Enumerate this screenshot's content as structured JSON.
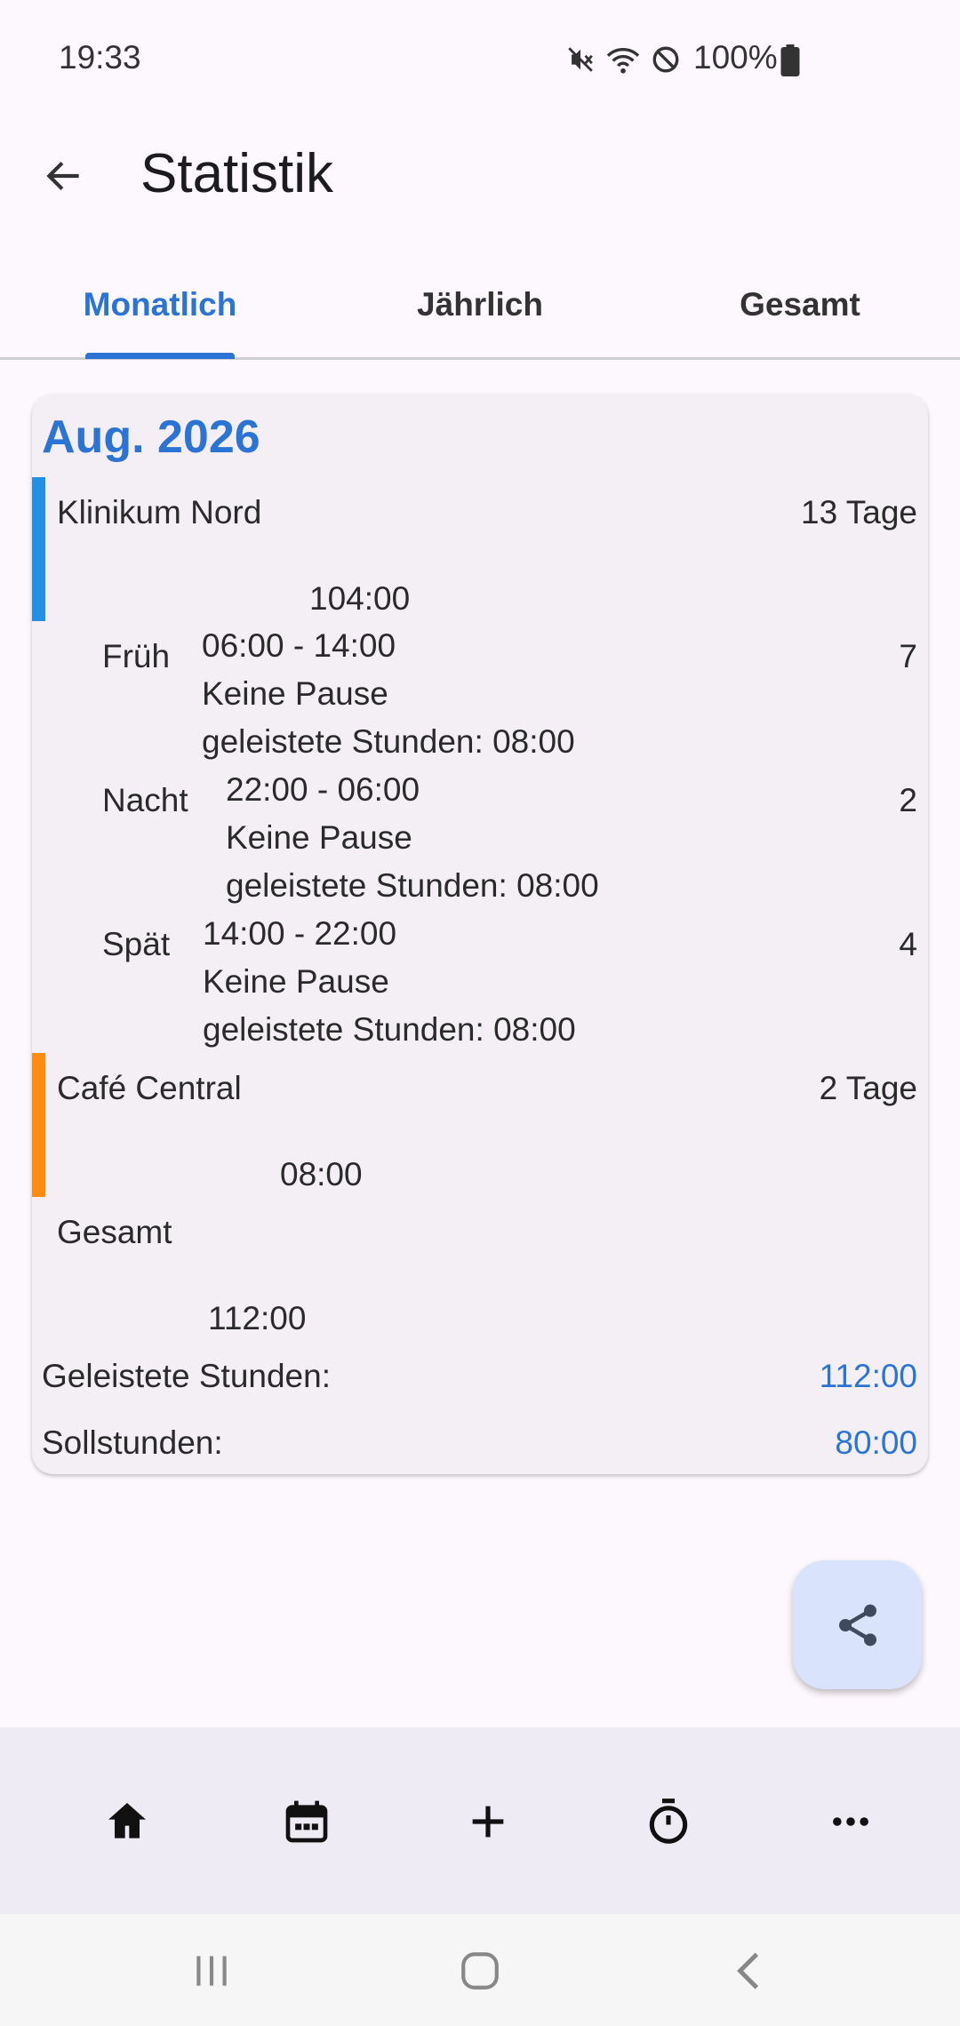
{
  "status_bar": {
    "time": "19:33",
    "battery": "100%",
    "icons": [
      "mute-icon",
      "wifi-icon",
      "dnd-icon",
      "battery-icon"
    ]
  },
  "app_bar": {
    "title": "Statistik",
    "back_icon": "arrow-left-icon"
  },
  "tabs": [
    {
      "label": "Monatlich",
      "active": true
    },
    {
      "label": "Jährlich",
      "active": false
    },
    {
      "label": "Gesamt",
      "active": false
    }
  ],
  "card": {
    "month": "Aug. 2026",
    "employers": [
      {
        "name": "Klinikum Nord",
        "days": "13 Tage",
        "total": "104:00",
        "color": "#2390e3",
        "shifts": [
          {
            "name": "Früh",
            "time": "06:00 - 14:00",
            "pause": "Keine Pause",
            "hours": "geleistete Stunden: 08:00",
            "count": "7"
          },
          {
            "name": "Nacht",
            "time": "22:00 - 06:00",
            "pause": "Keine Pause",
            "hours": "geleistete Stunden: 08:00",
            "count": "2"
          },
          {
            "name": "Spät",
            "time": "14:00 - 22:00",
            "pause": "Keine Pause",
            "hours": "geleistete Stunden: 08:00",
            "count": "4"
          }
        ]
      },
      {
        "name": "Café Central",
        "days": "2 Tage",
        "total": "08:00",
        "color": "#ff8c0f",
        "shifts": []
      }
    ],
    "total_label": "Gesamt",
    "total_value": "112:00",
    "worked_label": "Geleistete Stunden:",
    "worked_value": "112:00",
    "target_label": "Sollstunden:",
    "target_value": "80:00"
  },
  "fab": {
    "icon": "share-icon"
  },
  "bottom_nav": [
    "home-icon",
    "calendar-icon",
    "add-icon",
    "timer-icon",
    "more-icon"
  ],
  "system_nav": [
    "recent-apps-icon",
    "home-circle-icon",
    "back-chevron-icon"
  ],
  "colors": {
    "accent": "#2b74d6",
    "blue_bar": "#2390e3",
    "orange_bar": "#ff8c0f"
  }
}
